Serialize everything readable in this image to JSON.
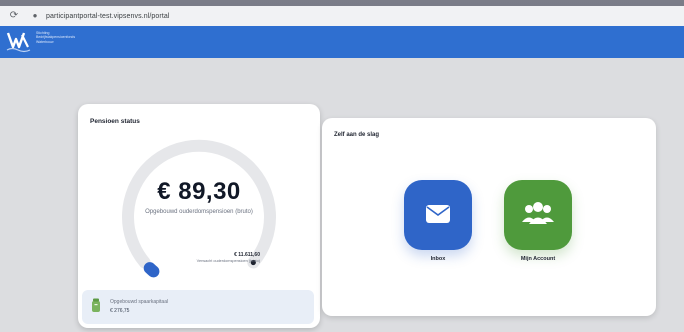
{
  "browser": {
    "url": "participantportal-test.vipsenvs.nl/portal"
  },
  "header": {
    "org_lines": [
      "Stichting",
      "Bedrijfstakpensioenfonds",
      "Waterbouw"
    ]
  },
  "status_card": {
    "title": "Pensioen status",
    "amount": "€ 89,30",
    "amount_label": "Opgebouwd ouderdomspensioen (bruto)",
    "gauge_fraction": 0.0077,
    "expected_amount": "€ 11.611,60",
    "expected_label": "Verwacht ouderdomspensioen (bruto)",
    "savings_label": "Opgebouwd spaarkapitaal",
    "savings_value": "€ 276,75"
  },
  "action_card": {
    "title": "Zelf aan de slag",
    "tiles": [
      {
        "label": "Inbox",
        "icon": "envelope-icon",
        "color": "#2f65c8"
      },
      {
        "label": "Mijn Account",
        "icon": "users-icon",
        "color": "#4f9a3c"
      }
    ]
  },
  "colors": {
    "brand_blue": "#2f6fd0",
    "gauge_track": "#e6e7ea",
    "gauge_fill": "#2f65c8"
  }
}
